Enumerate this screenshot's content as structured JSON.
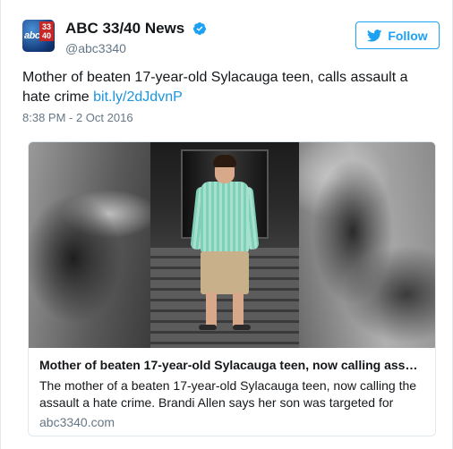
{
  "account": {
    "display_name": "ABC 33/40 News",
    "handle": "@abc3340",
    "avatar": {
      "brand_text": "abc",
      "channel_text": "33\n40",
      "brand_color": "#133a7a",
      "accent_color": "#c62828"
    },
    "verified_icon": "verified-badge-icon",
    "verified_color": "#1da1f2"
  },
  "follow_button": {
    "label": "Follow",
    "icon": "bird-icon",
    "color": "#1da1f2"
  },
  "tweet": {
    "text": "Mother of beaten 17-year-old Sylacauga teen, calls assault a hate crime",
    "link": "bit.ly/2dJdvnP",
    "timestamp": "8:38 PM - 2 Oct 2016"
  },
  "card": {
    "title": "Mother of beaten 17-year-old Sylacauga teen, now calling ass…",
    "description": "The mother of a beaten 17-year-old Sylacauga teen, now calling the assault a hate crime. Brandi Allen says her son was targeted for",
    "domain": "abc3340.com"
  },
  "colors": {
    "text": "#14171a",
    "secondary": "#657786",
    "link": "#1b95e0"
  }
}
